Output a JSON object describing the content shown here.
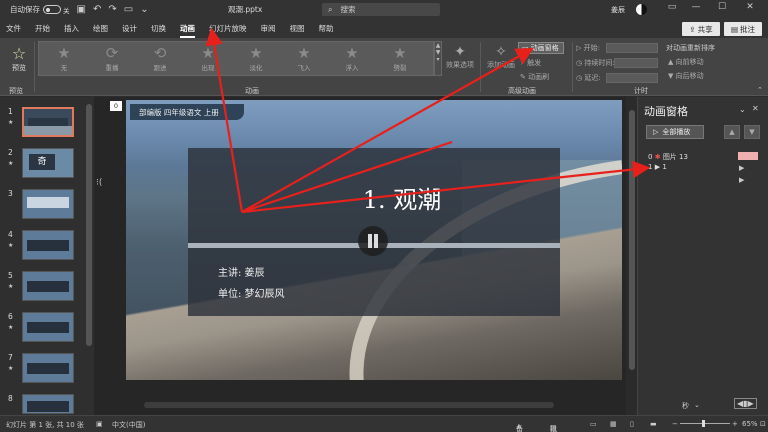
{
  "titlebar": {
    "autosave_label": "自动保存",
    "autosave_state": "关",
    "doc_title": "观潮.pptx",
    "search_placeholder": "搜索",
    "user_name": "姜辰"
  },
  "menu": {
    "tabs": [
      "文件",
      "开始",
      "插入",
      "绘图",
      "设计",
      "切换",
      "动画",
      "幻灯片放映",
      "审阅",
      "视图",
      "帮助"
    ],
    "active_tab": "动画",
    "share_label": "共享",
    "comment_label": "批注"
  },
  "ribbon": {
    "preview_label": "预览",
    "preview_group": "预览",
    "animation_group": "动画",
    "advanced_group": "高级动画",
    "timing_group": "计时",
    "animations": [
      "无",
      "重播",
      "跟进",
      "出现",
      "淡化",
      "飞入",
      "浮入",
      "劈裂"
    ],
    "effect_options": "效果选项",
    "add_animation": "添加动画",
    "animation_pane": "动画窗格",
    "trigger": "触发",
    "animation_painter": "动画刷",
    "start_label": "开始:",
    "duration_label": "持续时间:",
    "delay_label": "延迟:",
    "reorder_title": "对动画重新排序",
    "move_earlier": "向前移动",
    "move_later": "向后移动"
  },
  "thumbnails": {
    "numbers": [
      "1",
      "2",
      "3",
      "4",
      "5",
      "6",
      "7",
      "8"
    ],
    "selected": 1,
    "slide2_text": "奇"
  },
  "slide": {
    "corner_index": "0",
    "badge": "部编版 四年级语文 上册",
    "title": "1. 观潮",
    "lecturer": "主讲: 姜辰",
    "unit": "单位: 梦幻辰风"
  },
  "animation_pane": {
    "title": "动画窗格",
    "play_all": "全部播放",
    "items": [
      {
        "index": "0",
        "name": "图片 13"
      },
      {
        "index": "1",
        "name": "1"
      }
    ]
  },
  "status": {
    "slide_info": "幻灯片 第 1 张, 共 10 张",
    "language": "中文(中国)",
    "notes": "备注",
    "comments": "批注",
    "zoom": "65%",
    "seconds_unit": "秒"
  },
  "colors": {
    "annotation_arrow": "#e8201c",
    "selected_thumb": "#e07a5f"
  }
}
